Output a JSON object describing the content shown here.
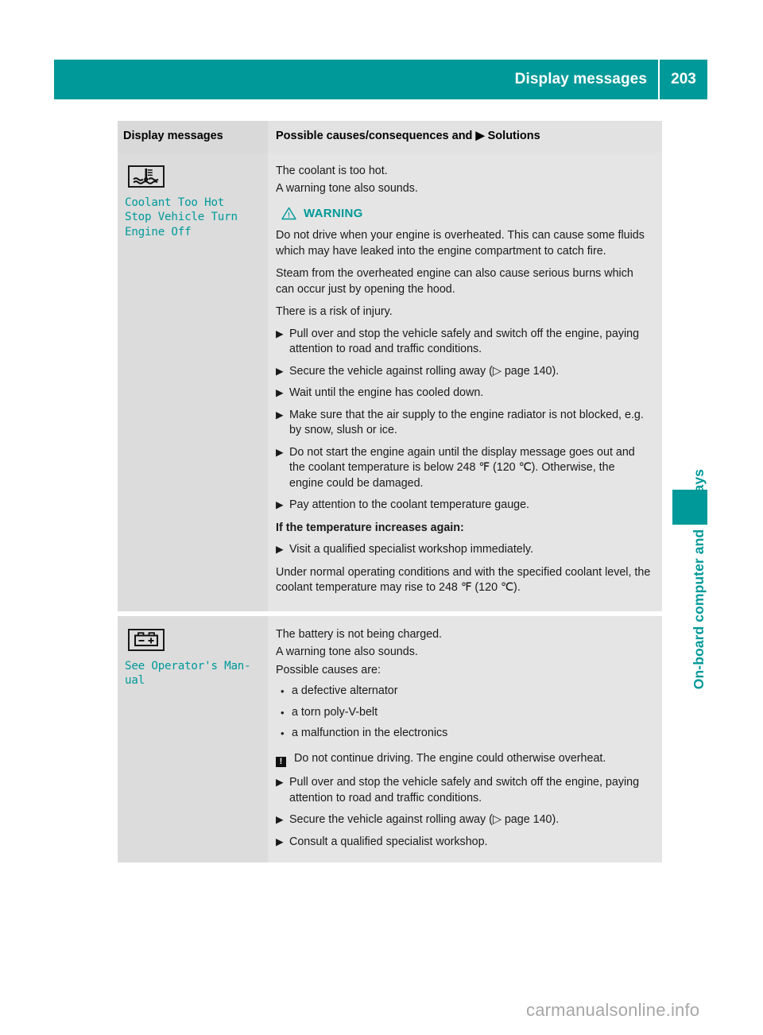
{
  "header": {
    "title": "Display messages",
    "page_number": "203",
    "bar_color": "#009999"
  },
  "side_tab": {
    "label": "On-board computer and displays",
    "color": "#009999"
  },
  "table": {
    "columns": {
      "left_header": "Display messages",
      "right_header_before": "Possible causes/consequences and",
      "right_header_marker": "▶",
      "right_header_after": "Solutions"
    },
    "rows": [
      {
        "icon_name": "coolant-temperature-icon",
        "display_message": "Coolant Too Hot\nStop Vehicle Turn\nEngine Off",
        "intro": [
          "The coolant is too hot.",
          "A warning tone also sounds."
        ],
        "warning": {
          "label": "WARNING",
          "paragraphs": [
            "Do not drive when your engine is overheated. This can cause some fluids which may have leaked into the engine compartment to catch fire.",
            "Steam from the overheated engine can also cause serious burns which can occur just by opening the hood.",
            "There is a risk of injury."
          ]
        },
        "solutions": [
          "Pull over and stop the vehicle safely and switch off the engine, paying attention to road and traffic conditions.",
          "Secure the vehicle against rolling away (▷ page 140).",
          "Wait until the engine has cooled down.",
          "Make sure that the air supply to the engine radiator is not blocked, e.g. by snow, slush or ice.",
          "Do not start the engine again until the display message goes out and the coolant temperature is below 248 ℉ (120 ℃). Otherwise, the engine could be damaged.",
          "Pay attention to the coolant temperature gauge."
        ],
        "subheading": "If the temperature increases again:",
        "solutions_after": [
          "Visit a qualified specialist workshop immediately."
        ],
        "closing": "Under normal operating conditions and with the specified coolant level, the coolant temperature may rise to 248 ℉ (120 ℃)."
      },
      {
        "icon_name": "battery-icon",
        "display_message": "See Operator's Man‐\nual",
        "intro": [
          "The battery is not being charged.",
          "A warning tone also sounds.",
          "Possible causes are:"
        ],
        "causes": [
          "a defective alternator",
          "a torn poly-V-belt",
          "a malfunction in the electronics"
        ],
        "notice": "Do not continue driving. The engine could otherwise overheat.",
        "solutions": [
          "Pull over and stop the vehicle safely and switch off the engine, paying attention to road and traffic conditions.",
          "Secure the vehicle against rolling away (▷ page 140).",
          "Consult a qualified specialist workshop."
        ]
      }
    ]
  },
  "markers": {
    "arrow": "▶",
    "dot": "•",
    "notice_glyph": "!"
  },
  "watermark": "carmanualsonline.info"
}
